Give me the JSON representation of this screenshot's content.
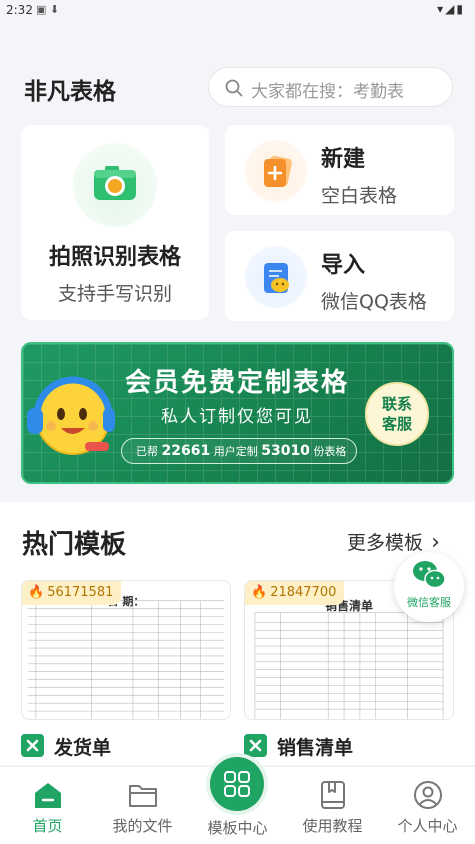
{
  "status_bar": {
    "time": "2:32",
    "left_icons": "▣ ⬇",
    "right_icons": "▾◢▮"
  },
  "header": {
    "app_title": "非凡表格",
    "search_placeholder": "大家都在搜：考勤表"
  },
  "feature_cards": {
    "photo": {
      "title": "拍照识别表格",
      "subtitle": "支持手写识别"
    },
    "new": {
      "title": "新建",
      "subtitle": "空白表格"
    },
    "import": {
      "title": "导入",
      "subtitle": "微信QQ表格"
    }
  },
  "banner": {
    "title": "会员免费定制表格",
    "subtitle": "私人订制仅您可见",
    "stat_prefix": "已帮",
    "users_count": "22661",
    "stat_middle": "用户定制",
    "tables_count": "53010",
    "stat_suffix": "份表格",
    "contact_line1": "联系",
    "contact_line2": "客服"
  },
  "hot_templates": {
    "section_title": "热门模板",
    "more_label": "更多模板",
    "items": [
      {
        "name": "发货单",
        "hot_count": "56171581",
        "sheet_title": "日 期："
      },
      {
        "name": "销售清单",
        "hot_count": "21847700",
        "sheet_title": "销售清单"
      }
    ]
  },
  "floating_service": {
    "label": "微信客服"
  },
  "bottom_nav": {
    "items": [
      {
        "label": "首页",
        "icon": "home-icon"
      },
      {
        "label": "我的文件",
        "icon": "folder-icon"
      },
      {
        "label": "模板中心",
        "icon": "grid-icon"
      },
      {
        "label": "使用教程",
        "icon": "book-icon"
      },
      {
        "label": "个人中心",
        "icon": "user-icon"
      }
    ],
    "active_index": 0
  },
  "colors": {
    "brand_green": "#1fa463",
    "banner_green": "#17834f",
    "hot_badge": "#fdf0c6",
    "orange": "#f59b2f"
  }
}
